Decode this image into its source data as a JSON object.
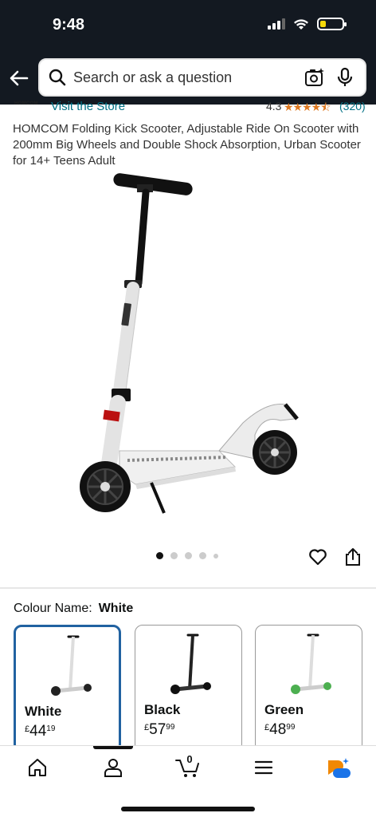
{
  "status_bar": {
    "time": "9:48"
  },
  "search": {
    "placeholder": "Search or ask a question"
  },
  "store": {
    "logo_text": "HOMCOM",
    "link": "Visit the Store",
    "rating": "4.3",
    "stars": "★★★★⯪",
    "rating_count": "(320)"
  },
  "product": {
    "title": "HOMCOM Folding Kick Scooter, Adjustable Ride On Scooter with 200mm Big Wheels and Double Shock Absorption, Urban Scooter for 14+ Teens Adult",
    "image_count": 5,
    "active_image": 1
  },
  "colour": {
    "label": "Colour Name:",
    "selected": "White",
    "options": [
      {
        "name": "White",
        "currency": "£",
        "whole": "44",
        "fraction": "19",
        "color": "#e8e8e8"
      },
      {
        "name": "Black",
        "currency": "£",
        "whole": "57",
        "fraction": "99",
        "color": "#222222"
      },
      {
        "name": "Green",
        "currency": "£",
        "whole": "48",
        "fraction": "99",
        "color": "#4caf50"
      }
    ]
  },
  "bottom_nav": {
    "items": [
      "home-icon",
      "account-icon",
      "cart-icon",
      "menu-icon",
      "rufus-icon"
    ],
    "cart_count": "0"
  },
  "colors": {
    "header": "#131921",
    "link": "#007185",
    "star": "#de7921",
    "selected_border": "#2162a1"
  }
}
